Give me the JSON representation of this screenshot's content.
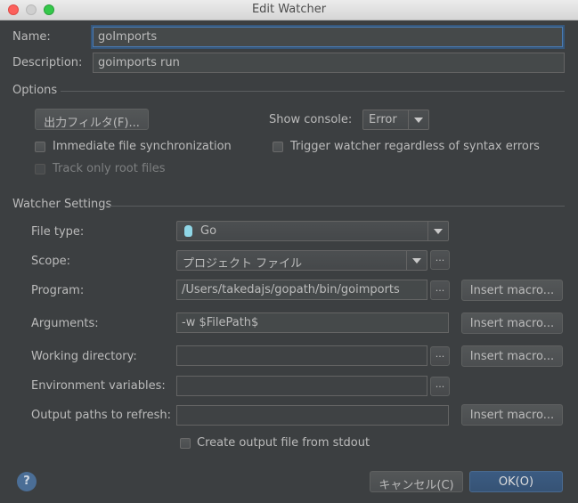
{
  "window": {
    "title": "Edit Watcher"
  },
  "form": {
    "name_label": "Name:",
    "name_value": "goImports",
    "description_label": "Description:",
    "description_value": "goimports run"
  },
  "options": {
    "section_title": "Options",
    "output_filter_button": "出力フィルタ(F)...",
    "show_console_label": "Show console:",
    "show_console_value": "Error",
    "immediate_sync_label": "Immediate file synchronization",
    "trigger_watcher_label": "Trigger watcher regardless of syntax errors",
    "track_root_label": "Track only root files"
  },
  "watcher": {
    "section_title": "Watcher Settings",
    "file_type_label": "File type:",
    "file_type_value": "Go",
    "file_type_icon": "gopher-icon",
    "scope_label": "Scope:",
    "scope_value": "プロジェクト ファイル",
    "program_label": "Program:",
    "program_value": "/Users/takedajs/gopath/bin/goimports",
    "arguments_label": "Arguments:",
    "arguments_value": "-w $FilePath$",
    "working_dir_label": "Working directory:",
    "working_dir_value": "",
    "env_vars_label": "Environment variables:",
    "env_vars_value": "",
    "output_paths_label": "Output paths to refresh:",
    "output_paths_value": "",
    "browse_label": "...",
    "insert_macro_label": "Insert macro...",
    "create_output_label": "Create output file from stdout"
  },
  "footer": {
    "help_label": "?",
    "cancel_label": "キャンセル(C)",
    "ok_label": "OK(O)"
  },
  "colors": {
    "background": "#3c3f41",
    "field": "#45494a",
    "focus": "#4a7bb5",
    "default_button": "#365375"
  }
}
